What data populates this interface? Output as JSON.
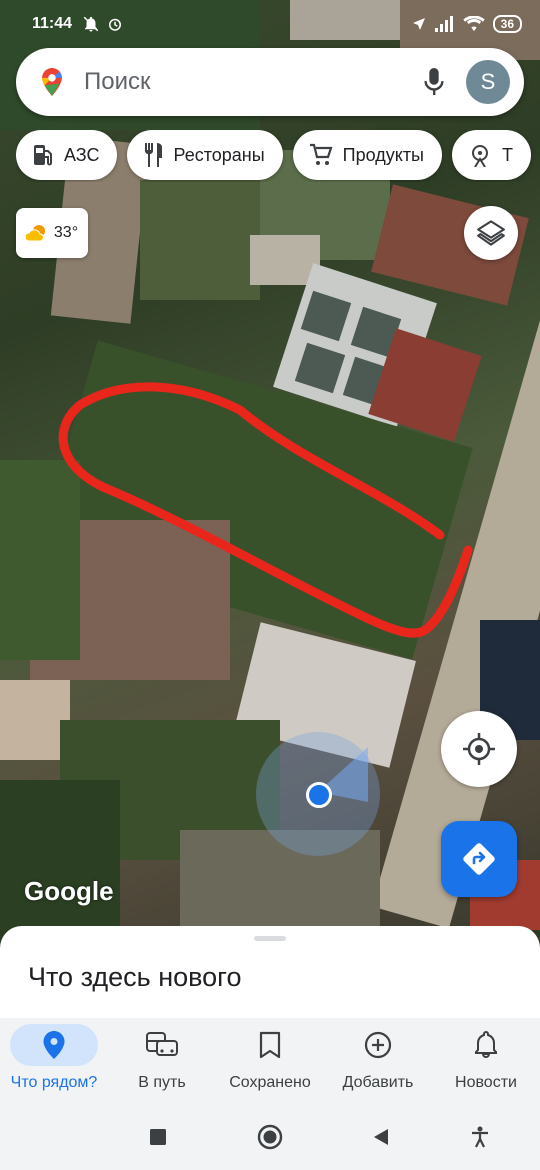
{
  "status_bar": {
    "time": "11:44",
    "battery": "36"
  },
  "search": {
    "placeholder": "Поиск",
    "avatar_letter": "S"
  },
  "chips": [
    {
      "label": "АЗС",
      "icon": "gas-station-icon"
    },
    {
      "label": "Рестораны",
      "icon": "restaurant-icon"
    },
    {
      "label": "Продукты",
      "icon": "cart-icon"
    },
    {
      "label": "Т",
      "icon": "attraction-icon"
    }
  ],
  "weather": {
    "temp": "33°",
    "icon": "partly-sunny-icon"
  },
  "map": {
    "attribution": "Google",
    "annotation_color": "#e8261b"
  },
  "sheet": {
    "title": "Что здесь нового"
  },
  "nav": {
    "items": [
      {
        "label": "Что рядом?",
        "icon": "location-pin-icon",
        "active": true
      },
      {
        "label": "В путь",
        "icon": "commute-icon",
        "active": false
      },
      {
        "label": "Сохранено",
        "icon": "bookmark-icon",
        "active": false
      },
      {
        "label": "Добавить",
        "icon": "add-circle-icon",
        "active": false
      },
      {
        "label": "Новости",
        "icon": "bell-icon",
        "active": false
      }
    ]
  },
  "colors": {
    "accent": "#1a73e8",
    "nav_bg": "#f1f3f4"
  }
}
